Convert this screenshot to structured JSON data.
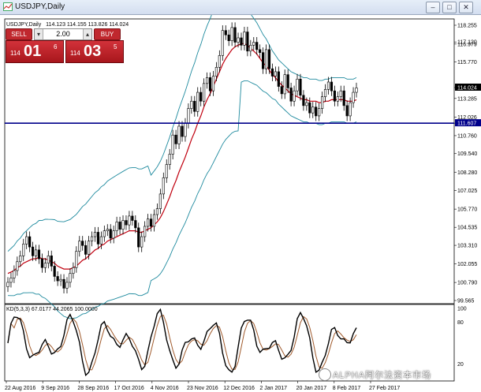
{
  "window": {
    "title": "USDJPY,Daily",
    "minimize_glyph": "–",
    "maximize_glyph": "□",
    "close_glyph": "✕"
  },
  "chart_info": {
    "symbol_period": "USDJPY,Daily",
    "ohlc": "114.123 114.155 113.826 114.024"
  },
  "trade_panel": {
    "sell_label": "SELL",
    "buy_label": "BUY",
    "lot_value": "2.00",
    "lot_dec_glyph": "▾",
    "lot_inc_glyph": "▴",
    "sell_quote": {
      "prefix": "114",
      "big": "01",
      "sup": "6"
    },
    "buy_quote": {
      "prefix": "114",
      "big": "03",
      "sup": "5"
    }
  },
  "oscillator": {
    "label": "KD(5,3,3) 67.0177 44.2065 100.0000",
    "levels": [
      "100",
      "80",
      "20"
    ]
  },
  "watermark": {
    "text": "ALPHA阿尔法资本市场"
  },
  "colors": {
    "candle": "#000000",
    "ma": "#c0000f",
    "bands": "#1e8a9e",
    "support": "#00008b",
    "osc_k": "#000000",
    "osc_d": "#a05a2c",
    "price_tag": "#000000",
    "support_tag": "#00008b"
  },
  "chart_data": {
    "type": "line",
    "price_ticks": [
      "118.255",
      "117.120",
      "116.979",
      "115.770",
      "114.024",
      "113.285",
      "112.026",
      "111.607",
      "110.760",
      "109.540",
      "108.280",
      "107.025",
      "105.770",
      "104.535",
      "103.310",
      "102.055",
      "100.790",
      "99.565"
    ],
    "current_price": "114.024",
    "support_level": 111.607,
    "support_label": "111.607",
    "date_ticks": [
      "22 Aug 2016",
      "9 Sep 2016",
      "28 Sep 2016",
      "17 Oct 2016",
      "4 Nov 2016",
      "23 Nov 2016",
      "12 Dec 2016",
      "2 Jan 2017",
      "20 Jan 2017",
      "8 Feb 2017",
      "27 Feb 2017"
    ],
    "ylim": [
      99.565,
      118.255
    ],
    "close_path": [
      100.8,
      101.1,
      101.6,
      102.2,
      102.6,
      103.4,
      103.9,
      103.2,
      102.6,
      103.0,
      102.4,
      101.8,
      102.1,
      102.6,
      101.9,
      101.2,
      100.9,
      101.0,
      100.4,
      100.8,
      101.4,
      101.8,
      102.9,
      103.6,
      103.3,
      102.7,
      103.6,
      103.9,
      104.2,
      103.4,
      103.9,
      104.3,
      104.4,
      103.8,
      104.3,
      104.9,
      104.4,
      105.0,
      104.7,
      105.3,
      105.0,
      104.5,
      103.2,
      103.9,
      104.6,
      105.1,
      104.6,
      105.4,
      105.8,
      106.8,
      107.9,
      108.8,
      109.5,
      110.8,
      110.2,
      111.4,
      110.7,
      111.6,
      112.6,
      113.1,
      112.4,
      113.7,
      113.1,
      114.3,
      114.7,
      113.8,
      114.8,
      115.4,
      116.2,
      117.9,
      117.6,
      117.2,
      118.1,
      117.1,
      117.4,
      116.9,
      117.8,
      116.5,
      116.9,
      117.1,
      116.6,
      116.4,
      115.3,
      116.6,
      115.3,
      114.8,
      115.1,
      114.1,
      113.6,
      114.9,
      114.0,
      113.1,
      113.8,
      114.6,
      113.5,
      112.8,
      113.0,
      112.3,
      112.7,
      112.1,
      112.6,
      113.4,
      113.9,
      114.4,
      113.8,
      113.1,
      113.4,
      113.8,
      112.8,
      112.1,
      113.0,
      113.7,
      114.0
    ],
    "ma_path": [
      101.4,
      101.5,
      101.6,
      101.8,
      101.9,
      102.1,
      102.2,
      102.3,
      102.4,
      102.4,
      102.5,
      102.4,
      102.4,
      102.3,
      102.2,
      102.1,
      101.9,
      101.8,
      101.7,
      101.7,
      101.7,
      101.8,
      101.9,
      102.1,
      102.3,
      102.4,
      102.6,
      102.8,
      103.0,
      103.1,
      103.3,
      103.4,
      103.6,
      103.7,
      103.8,
      103.9,
      104.0,
      104.1,
      104.2,
      104.3,
      104.3,
      104.3,
      104.2,
      104.2,
      104.3,
      104.4,
      104.5,
      104.7,
      104.9,
      105.2,
      105.6,
      106.1,
      106.6,
      107.2,
      107.7,
      108.3,
      108.8,
      109.3,
      109.9,
      110.5,
      111.0,
      111.6,
      112.1,
      112.7,
      113.2,
      113.6,
      114.1,
      114.6,
      115.1,
      115.6,
      116.0,
      116.3,
      116.6,
      116.8,
      116.9,
      117.0,
      117.0,
      116.9,
      116.7,
      116.5,
      116.3,
      116.0,
      115.7,
      115.5,
      115.2,
      114.9,
      114.7,
      114.4,
      114.2,
      114.0,
      113.8,
      113.6,
      113.5,
      113.4,
      113.3,
      113.2,
      113.2,
      113.1,
      113.1,
      113.1,
      113.0,
      113.0,
      113.1,
      113.1,
      113.2,
      113.2,
      113.2,
      113.2,
      113.2,
      113.1,
      113.1,
      113.1,
      113.2
    ],
    "series": [
      {
        "name": "",
        "values": []
      }
    ]
  }
}
